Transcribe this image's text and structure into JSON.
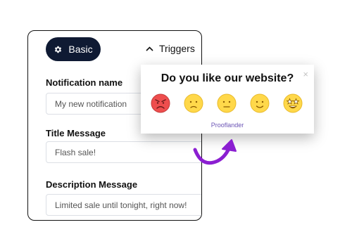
{
  "tabs": {
    "basic_label": "Basic",
    "triggers_label": "Triggers"
  },
  "form": {
    "notification_name": {
      "label": "Notification name",
      "placeholder": "My new notification"
    },
    "title_message": {
      "label": "Title Message",
      "value": "Flash sale!"
    },
    "description_message": {
      "label": "Description Message",
      "value": "Limited sale until tonight, right now!"
    }
  },
  "popup": {
    "title": "Do you like our website?",
    "close_glyph": "×",
    "brand": "Prooflander",
    "ratings": [
      "angry-face-icon",
      "sad-face-icon",
      "neutral-face-icon",
      "smiling-face-icon",
      "star-struck-face-icon"
    ]
  },
  "colors": {
    "tab_active_bg": "#0f1a33",
    "emoji_yellow": "#ffd84a",
    "emoji_red": "#ee4e4e",
    "arrow_purple": "#8b1fd1",
    "brand_text": "#6b54b5"
  }
}
